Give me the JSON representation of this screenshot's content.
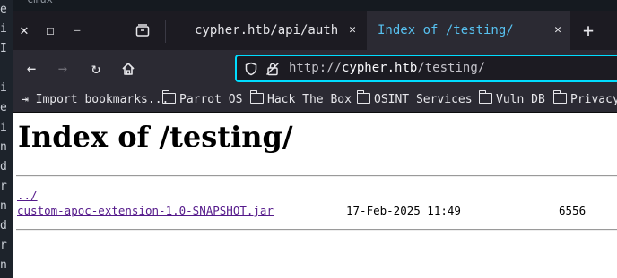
{
  "background": {
    "title_fragment": "cmux",
    "letters": [
      "e",
      "i",
      "I",
      "",
      "i",
      "e",
      "i",
      "n",
      "d",
      "r",
      "n",
      "d",
      "r",
      "n",
      "d"
    ]
  },
  "tabs": [
    {
      "label": "cypher.htb/api/auth",
      "close": "✕",
      "active": false
    },
    {
      "label": "Index of /testing/",
      "close": "✕",
      "active": true
    }
  ],
  "new_tab": "+",
  "window_controls": {
    "close": "✕",
    "maximize": "☐",
    "minimize": "—"
  },
  "url": {
    "scheme": "http://",
    "host": "cypher.htb",
    "path": "/testing/"
  },
  "bookmarks": [
    {
      "label": "Import bookmarks...",
      "icon": "import-icon"
    },
    {
      "label": "Parrot OS",
      "icon": "folder-icon"
    },
    {
      "label": "Hack The Box",
      "icon": "folder-icon"
    },
    {
      "label": "OSINT Services",
      "icon": "folder-icon"
    },
    {
      "label": "Vuln DB",
      "icon": "folder-icon"
    },
    {
      "label": "Privacy",
      "icon": "folder-icon"
    }
  ],
  "page": {
    "heading": "Index of /testing/",
    "parent_link": "../",
    "files": [
      {
        "name": "custom-apoc-extension-1.0-SNAPSHOT.jar",
        "date": "17-Feb-2025 11:49",
        "size": "6556"
      }
    ]
  },
  "colors": {
    "accent": "#00ddff",
    "active_tab_text": "#57c1f0",
    "link": "#551a8b"
  }
}
